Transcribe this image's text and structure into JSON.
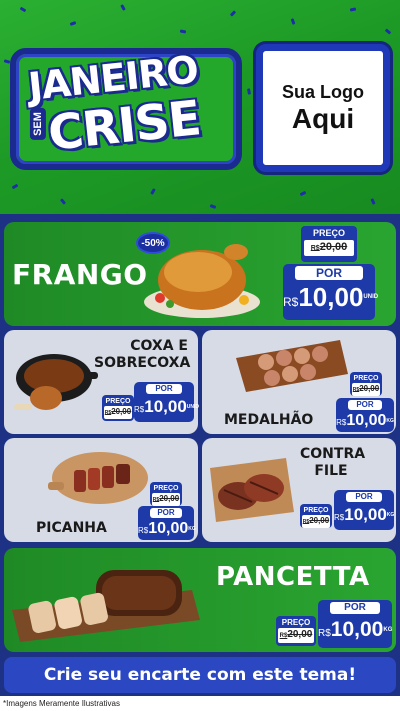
{
  "header": {
    "brand_line1": "JANEIRO",
    "brand_sem": "SEM",
    "brand_line2": "CRISE",
    "logo_line1": "Sua Logo",
    "logo_line2": "Aqui"
  },
  "labels": {
    "preco": "PREÇO",
    "por": "POR",
    "currency": "R$",
    "unit_unid": "UNID",
    "unit_kg": "KG"
  },
  "products": {
    "frango": {
      "name": "FRANGO",
      "discount": "-50%",
      "old_price": "20,00",
      "new_price": "10,00",
      "unit": "UNID"
    },
    "coxa": {
      "name_line1": "COXA E",
      "name_line2": "SOBRECOXA",
      "old_price": "20,00",
      "new_price": "10,00",
      "unit": "UNID"
    },
    "medalhao": {
      "name": "MEDALHÃO",
      "old_price": "20,00",
      "new_price": "10,00",
      "unit": "KG"
    },
    "picanha": {
      "name": "PICANHA",
      "old_price": "20,00",
      "new_price": "10,00",
      "unit": "KG"
    },
    "contra_file": {
      "name_line1": "CONTRA",
      "name_line2": "FILE",
      "old_price": "20,00",
      "new_price": "10,00",
      "unit": "KG"
    },
    "pancetta": {
      "name": "PANCETTA",
      "old_price": "20,00",
      "new_price": "10,00",
      "unit": "KG"
    }
  },
  "cta": {
    "text": "Crie seu encarte com este tema!"
  },
  "footer": {
    "disclaimer": "*Imagens Meramente Ilustrativas"
  },
  "colors": {
    "green": "#2aa531",
    "navy": "#1e3285",
    "tag_blue": "#1d3aa8",
    "card_grey": "#d6dbe6"
  },
  "icons": [
    "roast-chicken-image",
    "chicken-leg-pan-image",
    "medallion-skewers-image",
    "picanha-board-image",
    "steak-board-image",
    "pancetta-roll-image"
  ]
}
